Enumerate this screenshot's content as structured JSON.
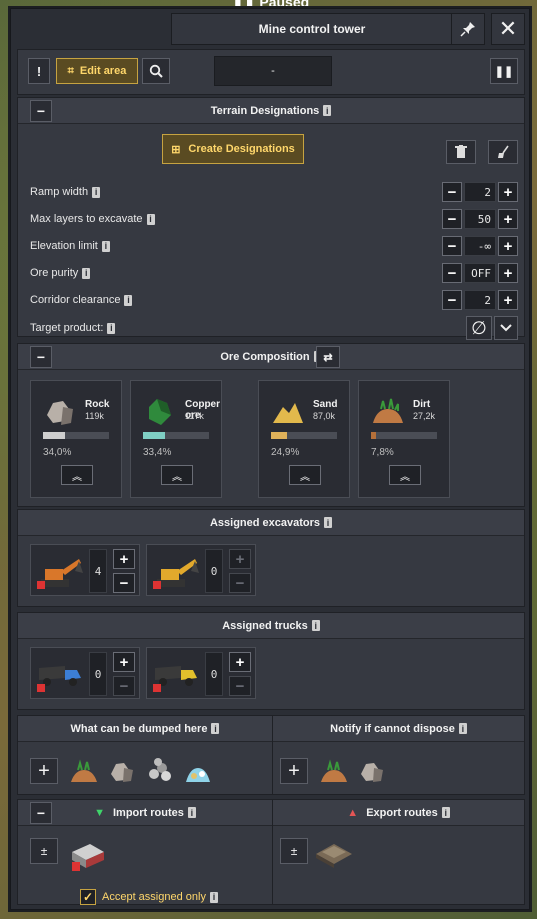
{
  "background": {
    "status_label": "Paused"
  },
  "window": {
    "title": "Mine control tower",
    "pin_icon": "pin-icon",
    "close_icon": "close-icon"
  },
  "toolbar": {
    "edit_area_label": "Edit area",
    "selector_value": "-"
  },
  "terrain": {
    "title": "Terrain Designations",
    "create_label": "Create Designations",
    "rows": [
      {
        "label": "Ramp width",
        "value": "2"
      },
      {
        "label": "Max layers to excavate",
        "value": "50"
      },
      {
        "label": "Elevation limit",
        "value": "-∞"
      },
      {
        "label": "Ore purity",
        "value": "OFF"
      },
      {
        "label": "Corridor clearance",
        "value": "2"
      }
    ],
    "target_label": "Target product:",
    "target_symbol": "∅"
  },
  "ore_composition": {
    "title": "Ore Composition",
    "items": [
      {
        "name": "Rock",
        "amount": "119k",
        "percent": "34,0%",
        "share": 0.34,
        "bar_color": "#cfcfcf"
      },
      {
        "name": "Copper ore",
        "amount": "117k",
        "percent": "33,4%",
        "share": 0.334,
        "bar_color": "#7fcfc4"
      },
      {
        "name": "Sand",
        "amount": "87,0k",
        "percent": "24,9%",
        "share": 0.249,
        "bar_color": "#e0b25a"
      },
      {
        "name": "Dirt",
        "amount": "27,2k",
        "percent": "7,8%",
        "share": 0.078,
        "bar_color": "#b5703a"
      }
    ]
  },
  "excavators": {
    "title": "Assigned excavators",
    "cards": [
      {
        "count": "4"
      },
      {
        "count": "0"
      }
    ]
  },
  "trucks": {
    "title": "Assigned trucks",
    "cards": [
      {
        "count": "0"
      },
      {
        "count": "0"
      }
    ]
  },
  "dump": {
    "left_title": "What can be dumped here",
    "right_title": "Notify if cannot dispose"
  },
  "routes": {
    "import_title": "Import routes",
    "export_title": "Export routes",
    "accept_label": "Accept assigned only"
  }
}
